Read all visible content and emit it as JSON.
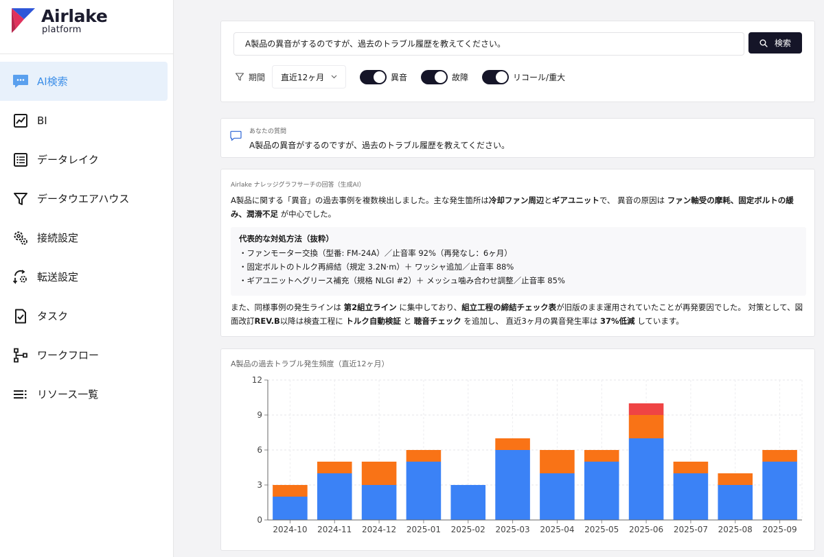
{
  "app": {
    "brand": "Airlake",
    "sub": "platform"
  },
  "sidebar": {
    "items": [
      {
        "label": "AI検索",
        "icon": "chat-bubble-icon",
        "active": true
      },
      {
        "label": "BI",
        "icon": "line-chart-icon",
        "active": false
      },
      {
        "label": "データレイク",
        "icon": "list-icon",
        "active": false
      },
      {
        "label": "データウエアハウス",
        "icon": "funnel-icon",
        "active": false
      },
      {
        "label": "接続設定",
        "icon": "gear-connect-icon",
        "active": false
      },
      {
        "label": "転送設定",
        "icon": "transfer-gear-icon",
        "active": false
      },
      {
        "label": "タスク",
        "icon": "task-check-icon",
        "active": false
      },
      {
        "label": "ワークフロー",
        "icon": "workflow-icon",
        "active": false
      },
      {
        "label": "リソース一覧",
        "icon": "resource-list-icon",
        "active": false
      }
    ]
  },
  "search": {
    "value": "A製品の異音がするのですが、過去のトラブル履歴を教えてください。",
    "button_label": "検索",
    "period_label": "期間",
    "period_value": "直近12ヶ月",
    "toggles": [
      {
        "label": "異音",
        "on": true
      },
      {
        "label": "故障",
        "on": true
      },
      {
        "label": "リコール/重大",
        "on": true
      }
    ]
  },
  "question": {
    "caption": "あなたの質問",
    "text": "A製品の異音がするのですが、過去のトラブル履歴を教えてください。"
  },
  "answer": {
    "header": "Airlake ナレッジグラフサーチの回答（生成AI）",
    "p1": [
      {
        "t": "A製品に関する「異音」の過去事例を複数検出しました。主な発生箇所は",
        "b": false
      },
      {
        "t": "冷却ファン周辺",
        "b": true
      },
      {
        "t": "と",
        "b": false
      },
      {
        "t": "ギアユニット",
        "b": true
      },
      {
        "t": "で、 異音の原因は ",
        "b": false
      },
      {
        "t": "ファン軸受の摩耗、固定ボルトの緩み、潤滑不足",
        "b": true
      },
      {
        "t": " が中心でした。",
        "b": false
      }
    ],
    "methods_title": "代表的な対処方法（抜粋）",
    "methods": [
      "・ファンモーター交換（型番: FM-24A）／止音率 92%（再発なし：6ヶ月）",
      "・固定ボルトのトルク再締結（規定 3.2N·m）＋ ワッシャ追加／止音率 88%",
      "・ギアユニットへグリース補充（規格 NLGI #2）＋ メッシュ噛み合わせ調整／止音率 85%"
    ],
    "p2": [
      {
        "t": "また、同様事例の発生ラインは ",
        "b": false
      },
      {
        "t": "第2組立ライン",
        "b": true
      },
      {
        "t": " に集中しており、",
        "b": false
      },
      {
        "t": "組立工程の締結チェック表",
        "b": true
      },
      {
        "t": "が旧版のまま運用されていたことが再発要因でした。 対策として、図面改訂",
        "b": false
      },
      {
        "t": "REV.B",
        "b": true
      },
      {
        "t": "以降は検査工程に ",
        "b": false
      },
      {
        "t": "トルク自動検証",
        "b": true
      },
      {
        "t": " と ",
        "b": false
      },
      {
        "t": "聴音チェック",
        "b": true
      },
      {
        "t": " を追加し、 直近3ヶ月の異音発生率は ",
        "b": false
      },
      {
        "t": "37%低減",
        "b": true
      },
      {
        "t": " しています。",
        "b": false
      }
    ]
  },
  "chart_data": {
    "type": "bar",
    "stacked": true,
    "title": "A製品の過去トラブル発生頻度（直近12ヶ月）",
    "categories": [
      "2024-10",
      "2024-11",
      "2024-12",
      "2025-01",
      "2025-02",
      "2025-03",
      "2025-04",
      "2025-05",
      "2025-06",
      "2025-07",
      "2025-08",
      "2025-09"
    ],
    "series": [
      {
        "color": "#3b82f6",
        "values": [
          2,
          4,
          3,
          5,
          3,
          6,
          4,
          5,
          7,
          4,
          3,
          5
        ]
      },
      {
        "color": "#f97316",
        "values": [
          1,
          1,
          2,
          1,
          0,
          1,
          2,
          1,
          2,
          1,
          1,
          1
        ]
      },
      {
        "color": "#ef4444",
        "values": [
          0,
          0,
          0,
          0,
          0,
          0,
          0,
          0,
          1,
          0,
          0,
          0
        ]
      }
    ],
    "ylim": [
      0,
      12
    ],
    "yticks": [
      0,
      3,
      6,
      9,
      12
    ],
    "grid": true
  }
}
